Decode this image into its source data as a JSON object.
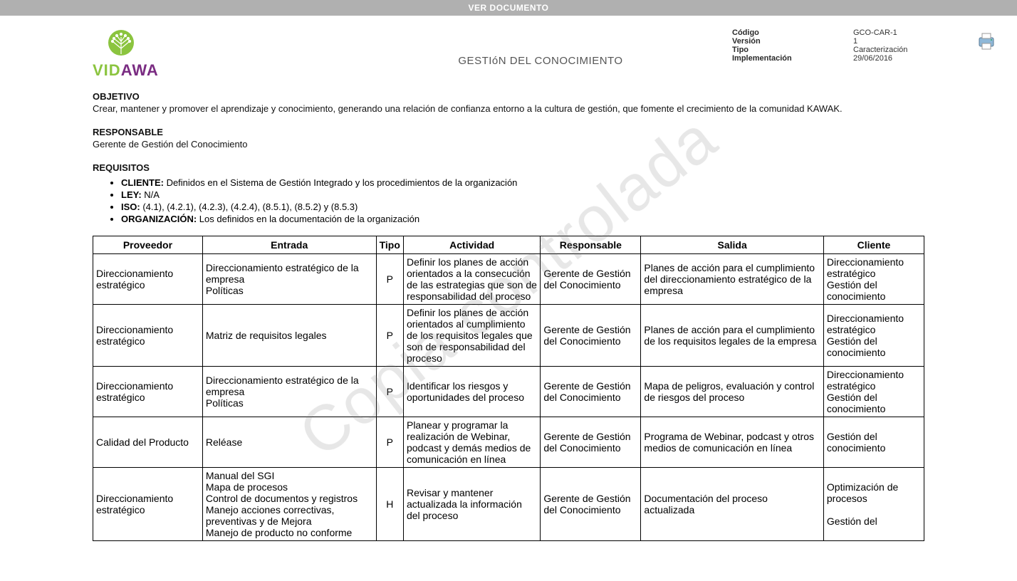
{
  "topbar": "VER DOCUMENTO",
  "title": "GESTIóN DEL CONOCIMIENTO",
  "watermark": "Copia controlada",
  "meta": {
    "labels": {
      "codigo": "Código",
      "version": "Versión",
      "tipo": "Tipo",
      "impl": "Implementación"
    },
    "values": {
      "codigo": "GCO-CAR-1",
      "version": "1",
      "tipo": "Caracterización",
      "impl": "29/06/2016"
    }
  },
  "sections": {
    "objetivo_h": "OBJETIVO",
    "objetivo_t": "Crear, mantener y promover el aprendizaje y conocimiento, generando una relación de confianza entorno a la cultura de gestión, que fomente  el crecimiento de la comunidad KAWAK.",
    "responsable_h": "RESPONSABLE",
    "responsable_t": "Gerente de Gestión del Conocimiento",
    "requisitos_h": "REQUISITOS"
  },
  "requisitos": [
    {
      "label": "CLIENTE:",
      "text": " Definidos en el Sistema de Gestión Integrado y los procedimientos de la organización"
    },
    {
      "label": "LEY:",
      "text": "  N/A"
    },
    {
      "label": "ISO:",
      "text": " (4.1), (4.2.1), (4.2.3), (4.2.4), (8.5.1), (8.5.2) y (8.5.3)"
    },
    {
      "label": "ORGANIZACIÓN:",
      "text": " Los definidos en la documentación de la organización"
    }
  ],
  "table": {
    "headers": [
      "Proveedor",
      "Entrada",
      "Tipo",
      "Actividad",
      "Responsable",
      "Salida",
      "Cliente"
    ],
    "rows": [
      {
        "proveedor": "Direccionamiento estratégico",
        "entrada": "Direccionamiento estratégico de la empresa\nPolíticas",
        "tipo": "P",
        "actividad": "Definir los planes de acción orientados a la consecución de las estrategias que son de responsabilidad del proceso",
        "responsable": "Gerente de Gestión del Conocimiento",
        "salida": "Planes de acción para el cumplimiento del direccionamiento estratégico de la empresa",
        "cliente": "Direccionamiento estratégico\nGestión del conocimiento"
      },
      {
        "proveedor": "Direccionamiento estratégico",
        "entrada": "Matriz de requisitos legales",
        "tipo": "P",
        "actividad": "Definir los planes de acción orientados al cumplimiento de los requisitos legales que son de responsabilidad del proceso",
        "responsable": "Gerente de Gestión del Conocimiento",
        "salida": "Planes de acción para el cumplimiento de los requisitos legales de la empresa",
        "cliente": "Direccionamiento estratégico\nGestión del conocimiento"
      },
      {
        "proveedor": "Direccionamiento estratégico",
        "entrada": "Direccionamiento estratégico de la empresa\nPolíticas",
        "tipo": "P",
        "actividad": "Identificar los riesgos y oportunidades del proceso",
        "responsable": "Gerente de Gestión del Conocimiento",
        "salida": "Mapa de peligros, evaluación y control de riesgos del proceso",
        "cliente": "Direccionamiento estratégico\nGestión del conocimiento"
      },
      {
        "proveedor": "Calidad del Producto",
        "entrada": "Reléase",
        "tipo": "P",
        "actividad": "Planear y programar la realización de Webinar, podcast y demás medios de comunicación en línea",
        "responsable": "Gerente de Gestión del Conocimiento",
        "salida": "Programa de Webinar, podcast y otros medios de comunicación en línea",
        "cliente": "Gestión del conocimiento"
      },
      {
        "proveedor": "Direccionamiento estratégico",
        "entrada": "Manual del SGI\nMapa de procesos\nControl de documentos y registros\nManejo acciones correctivas, preventivas y de Mejora\nManejo de producto no conforme",
        "tipo": "H",
        "actividad": "Revisar y mantener actualizada la información del proceso",
        "responsable": "Gerente de Gestión del Conocimiento",
        "salida": "Documentación del proceso actualizada",
        "cliente": "Optimización de procesos\n\nGestión del"
      }
    ]
  }
}
